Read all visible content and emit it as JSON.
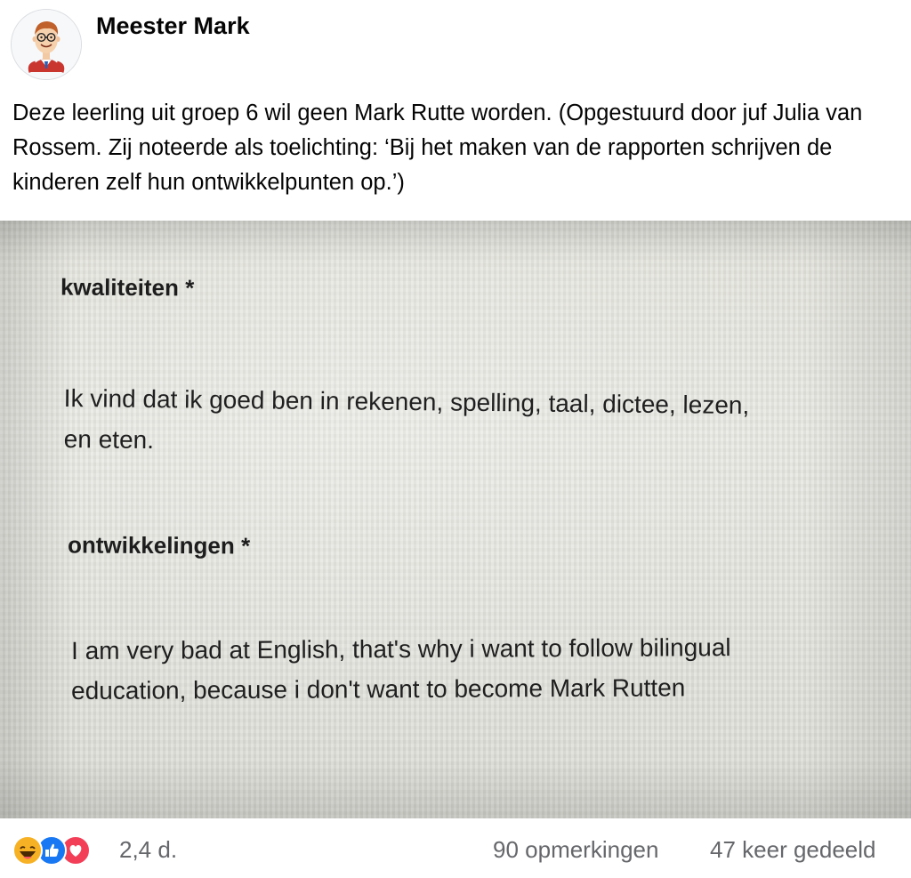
{
  "post": {
    "author": "Meester Mark",
    "text": "Deze leerling uit groep 6 wil geen Mark Rutte worden. (Opgestuurd door juf Julia van Rossem. Zij noteerde als toelichting: ‘Bij het maken van de rapporten schrijven de kinderen zelf hun ontwikkelpunten op.’)"
  },
  "photo": {
    "section1_label": "kwaliteiten *",
    "section1_line1": "Ik vind dat ik goed ben in rekenen, spelling, taal, dictee, lezen,",
    "section1_line2": "en eten.",
    "section2_label": "ontwikkelingen *",
    "section2_line1": "I am very bad at English, that's why i want to follow bilingual",
    "section2_line2": "education, because i don't want to become Mark Rutten"
  },
  "footer": {
    "reactions": [
      "haha-icon",
      "like-icon",
      "love-icon"
    ],
    "time": "2,4 d.",
    "comments": "90 opmerkingen",
    "shares": "47 keer gedeeld"
  },
  "colors": {
    "like": "#1877f2",
    "love": "#f33e58",
    "haha": "#f7b125",
    "meta_text": "#65676b"
  }
}
